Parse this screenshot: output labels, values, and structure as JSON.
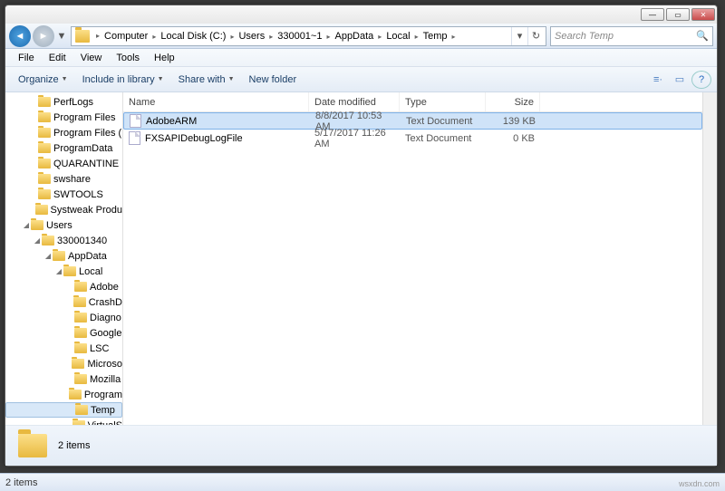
{
  "titlebar": {
    "min": "—",
    "max": "▭",
    "close": "✕"
  },
  "nav": {
    "back": "◄",
    "forward": "►",
    "dropdown": "▼",
    "refresh": "↻",
    "addr_dd": "▾"
  },
  "breadcrumb": [
    "Computer",
    "Local Disk (C:)",
    "Users",
    "330001~1",
    "AppData",
    "Local",
    "Temp"
  ],
  "search_placeholder": "Search Temp",
  "menu": [
    "File",
    "Edit",
    "View",
    "Tools",
    "Help"
  ],
  "toolbar": {
    "organize": "Organize",
    "include": "Include in library",
    "share": "Share with",
    "newfolder": "New folder"
  },
  "columns": {
    "name": "Name",
    "date": "Date modified",
    "type": "Type",
    "size": "Size"
  },
  "tree": [
    {
      "pad": 26,
      "exp": "",
      "label": "PerfLogs"
    },
    {
      "pad": 26,
      "exp": "",
      "label": "Program Files"
    },
    {
      "pad": 26,
      "exp": "",
      "label": "Program Files ("
    },
    {
      "pad": 26,
      "exp": "",
      "label": "ProgramData"
    },
    {
      "pad": 26,
      "exp": "",
      "label": "QUARANTINE"
    },
    {
      "pad": 26,
      "exp": "",
      "label": "swshare"
    },
    {
      "pad": 26,
      "exp": "",
      "label": "SWTOOLS"
    },
    {
      "pad": 26,
      "exp": "",
      "label": "Systweak Produ"
    },
    {
      "pad": 18,
      "exp": "◢",
      "label": "Users"
    },
    {
      "pad": 30,
      "exp": "◢",
      "label": "330001340"
    },
    {
      "pad": 42,
      "exp": "◢",
      "label": "AppData"
    },
    {
      "pad": 54,
      "exp": "◢",
      "label": "Local"
    },
    {
      "pad": 66,
      "exp": "",
      "label": "Adobe"
    },
    {
      "pad": 66,
      "exp": "",
      "label": "CrashD"
    },
    {
      "pad": 66,
      "exp": "",
      "label": "Diagno"
    },
    {
      "pad": 66,
      "exp": "",
      "label": "Google"
    },
    {
      "pad": 66,
      "exp": "",
      "label": "LSC"
    },
    {
      "pad": 66,
      "exp": "",
      "label": "Microso"
    },
    {
      "pad": 66,
      "exp": "",
      "label": "Mozilla"
    },
    {
      "pad": 66,
      "exp": "",
      "label": "Program"
    },
    {
      "pad": 66,
      "exp": "",
      "label": "Temp",
      "sel": true
    },
    {
      "pad": 66,
      "exp": "",
      "label": "VirtualS"
    }
  ],
  "files": [
    {
      "name": "AdobeARM",
      "date": "8/8/2017 10:53 AM",
      "type": "Text Document",
      "size": "139 KB",
      "sel": true
    },
    {
      "name": "FXSAPIDebugLogFile",
      "date": "5/17/2017 11:26 AM",
      "type": "Text Document",
      "size": "0 KB"
    }
  ],
  "details": {
    "count": "2 items"
  },
  "status": "2 items",
  "watermark": "wsxdn.com"
}
